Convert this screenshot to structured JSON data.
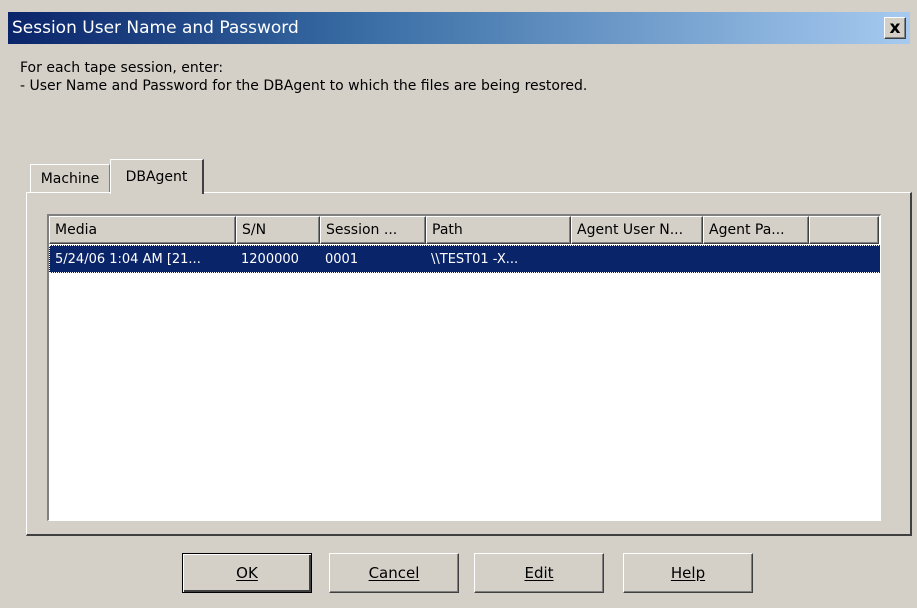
{
  "window": {
    "title": "Session User Name and Password",
    "close_glyph": "x",
    "title_bar_color_start": "#0a246a",
    "title_bar_color_end": "#a6caf0",
    "background": "#d4d0c8"
  },
  "instructions": {
    "line1": "For each tape session, enter:",
    "line2": "- User Name and Password for the DBAgent to which the files are being restored."
  },
  "tabs": [
    {
      "label": "Machine",
      "selected": false
    },
    {
      "label": "DBAgent",
      "selected": true
    }
  ],
  "table": {
    "columns": [
      "Media",
      "S/N",
      "Session ...",
      "Path",
      "Agent User N...",
      "Agent Pa...",
      ""
    ],
    "rows": [
      {
        "media": "5/24/06 1:04 AM [21...",
        "sn": "1200000",
        "session": "0001",
        "path": "\\\\TEST01 -X...",
        "agent_user": "",
        "agent_password": "",
        "selected": true
      }
    ],
    "selection_color": "#0a246a"
  },
  "buttons": {
    "ok": "OK",
    "cancel": "Cancel",
    "edit": "Edit",
    "help": "Help"
  }
}
